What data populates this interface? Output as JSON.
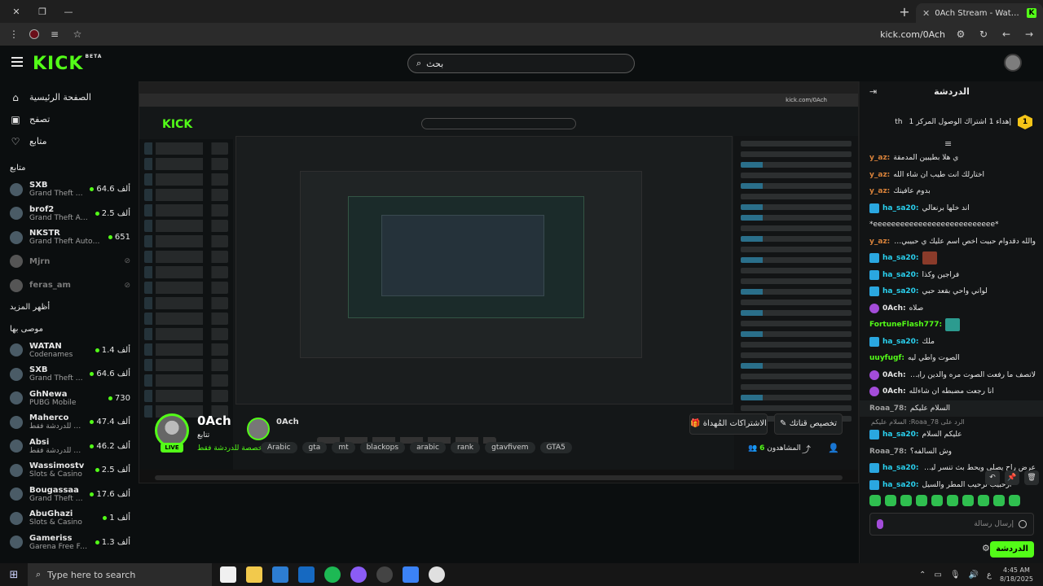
{
  "browser": {
    "tab_title": "0Ach Stream - Watch Live on Kick",
    "url": "kick.com/0Ach",
    "window_controls": [
      "×",
      "❐",
      "—"
    ],
    "new_tab": "+"
  },
  "header": {
    "logo": "KICK",
    "logo_tag": "BETA",
    "search_placeholder": "بحث"
  },
  "sidebar": {
    "nav": [
      {
        "label": "الصفحة الرئيسية",
        "icon": "home-icon"
      },
      {
        "label": "تصفح",
        "icon": "browse-icon"
      },
      {
        "label": "متابع",
        "icon": "heart-icon"
      }
    ],
    "following_title": "متابع",
    "following": [
      {
        "name": "SXB",
        "category": "Grand Theft Auto ...",
        "viewers": "64.6 ألف"
      },
      {
        "name": "brof2",
        "category": "Grand Theft Auto V...",
        "viewers": "2.5 ألف"
      },
      {
        "name": "NKSTR",
        "category": "Grand Theft Auto V (G...",
        "viewers": "651"
      },
      {
        "name": "Mjrn",
        "category": "",
        "viewers": ""
      },
      {
        "name": "feras_am",
        "category": "",
        "viewers": ""
      }
    ],
    "show_more": "أظهر المزيد",
    "recommended_title": "موصى بها",
    "recommended": [
      {
        "name": "WATAN",
        "category": "Codenames",
        "viewers": "1.4 ألف"
      },
      {
        "name": "SXB",
        "category": "Grand Theft Auto ...",
        "viewers": "64.6 ألف"
      },
      {
        "name": "GhNewa",
        "category": "PUBG Mobile",
        "viewers": "730"
      },
      {
        "name": "Maherco",
        "category": "مخصصة للدردشة فقط",
        "viewers": "47.4 ألف"
      },
      {
        "name": "Absi",
        "category": "مخصصة للدردشة فقط",
        "viewers": "46.2 ألف"
      },
      {
        "name": "Wassimostv",
        "category": "Slots & Casino",
        "viewers": "2.5 ألف"
      },
      {
        "name": "Bougassaa",
        "category": "Grand Theft Auto ...",
        "viewers": "17.6 ألف"
      },
      {
        "name": "AbuGhazi",
        "category": "Slots & Casino",
        "viewers": "1 ألف"
      },
      {
        "name": "Gameriss",
        "category": "Garena Free Fire",
        "viewers": "1.3 ألف"
      }
    ]
  },
  "stream": {
    "streamer": "0Ach",
    "follow_label": "تتابع",
    "live_badge": "LIVE",
    "category": "مخصصة للدردشة فقط",
    "tags": [
      "Arabic",
      "gta",
      "mt",
      "blackops",
      "arabic",
      "rank",
      "gtavfivem",
      "GTA5"
    ],
    "customize_label": "تخصيص قناتك",
    "subs_label": "الاشتراكات المُهداة",
    "viewers_label": "المشاهدون",
    "viewers_count": "6"
  },
  "chat": {
    "title": "الدردشة",
    "pinned": "إهداء 1 اشتراك الوصول المركز 1",
    "pinned_user": "th",
    "pinned_rank": "1",
    "messages": [
      {
        "user": "y_az:",
        "color": "y",
        "badge": "",
        "text": "ي هلا بطيبين المدمقة"
      },
      {
        "user": "y_az:",
        "color": "y",
        "badge": "",
        "text": "اختارلك انت طيب ان شاء الله"
      },
      {
        "user": "y_az:",
        "color": "y",
        "badge": "",
        "text": "بدوم عافيتك"
      },
      {
        "user": "ha_sa20:",
        "color": "b",
        "badge": "b",
        "text": "اند خلها برنعالي"
      },
      {
        "user": "",
        "color": "w",
        "badge": "",
        "text": "*eeeeeeeeeeeeeeeeeeeeeeeeeee*"
      },
      {
        "user": "y_az:",
        "color": "y",
        "badge": "",
        "text": "والله دقدوام حبيت اخص اسم عليك ي حبيبي انت"
      },
      {
        "user": "ha_sa20:",
        "color": "b",
        "badge": "b",
        "text": "",
        "emote": "r"
      },
      {
        "user": "ha_sa20:",
        "color": "b",
        "badge": "b",
        "text": "فراجين وكذا"
      },
      {
        "user": "ha_sa20:",
        "color": "b",
        "badge": "b",
        "text": "لواني واحي بقعد حبي"
      },
      {
        "user": "0Ach:",
        "color": "p",
        "badge": "p",
        "text": "صلاه"
      },
      {
        "user": "FortuneFlash777:",
        "color": "g",
        "badge": "",
        "text": "",
        "emote": "g"
      },
      {
        "user": "ha_sa20:",
        "color": "b",
        "badge": "b",
        "text": "ملك"
      },
      {
        "user": "uuyfugf:",
        "color": "g",
        "badge": "",
        "text": "الصوت واطي ليه"
      },
      {
        "user": "0Ach:",
        "color": "p",
        "badge": "p",
        "text": "لاتصف ما رفعت الصوت مره والدين رابع اصلي"
      },
      {
        "user": "0Ach:",
        "color": "p",
        "badge": "p",
        "text": "انا رجعت مضبطه ان شاءلله"
      },
      {
        "user": "Roaa_78:",
        "color": "gr",
        "badge": "",
        "text": "السلام عليكم"
      },
      {
        "user": "",
        "color": "w",
        "badge": "",
        "text": "الرد على Roaa_78: السلام عليكم",
        "reply": true
      },
      {
        "user": "ha_sa20:",
        "color": "b",
        "badge": "b",
        "text": "عليكم السلام"
      },
      {
        "user": "Roaa_78:",
        "color": "gr",
        "badge": "",
        "text": "وش السالفه؟"
      },
      {
        "user": "ha_sa20:",
        "color": "b",
        "badge": "b",
        "text": "عرض راح يصلي ويحط بث تنسر لين يرجع"
      },
      {
        "user": "ha_sa20:",
        "color": "b",
        "badge": "b",
        "text": "ارحبيب ترحيب المطر والسيل"
      }
    ],
    "input_placeholder": "إرسال رسالة",
    "send_label": "الدردشة"
  },
  "taskbar": {
    "search_placeholder": "Type here to search",
    "time": "4:45 AM",
    "date": "8/18/2025",
    "lang": "ع"
  },
  "colors": {
    "accent": "#53fc18",
    "background": "#0b0e0f"
  }
}
